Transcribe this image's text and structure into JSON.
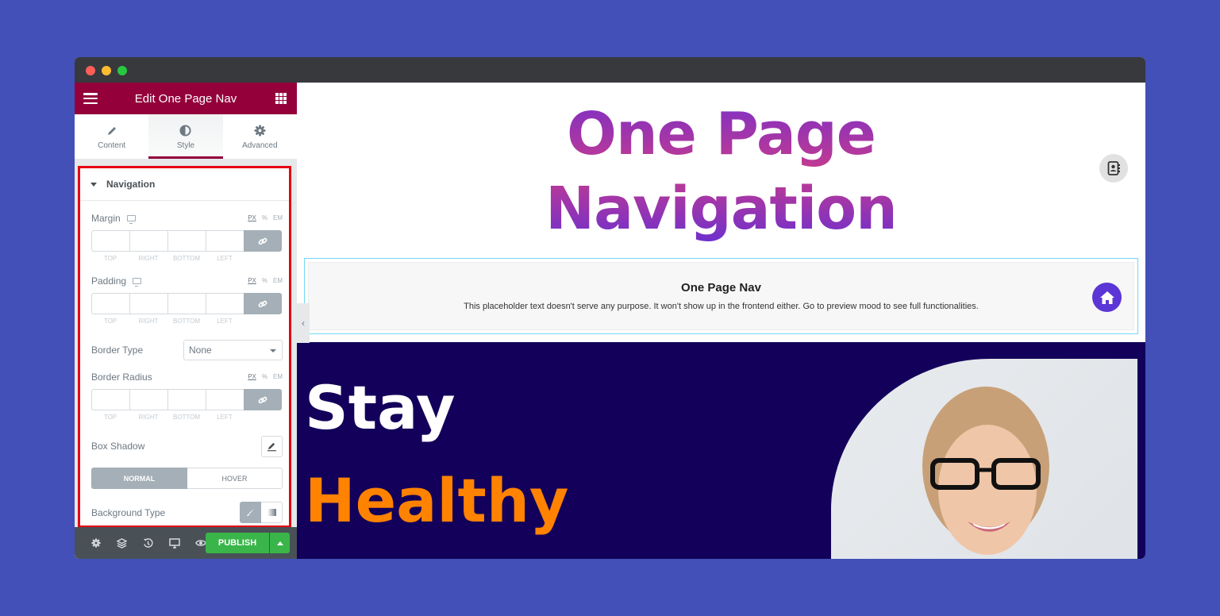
{
  "window": {
    "traffic_lights": [
      "close",
      "minimize",
      "maximize"
    ]
  },
  "sidebar": {
    "header_title": "Edit One Page Nav",
    "menu_icon": "hamburger-icon",
    "grid_icon": "apps-grid-icon",
    "tabs": [
      {
        "label": "Content",
        "icon": "pencil-icon",
        "active": false
      },
      {
        "label": "Style",
        "icon": "contrast-icon",
        "active": true
      },
      {
        "label": "Advanced",
        "icon": "gear-icon",
        "active": false
      }
    ],
    "section": {
      "title": "Navigation",
      "expanded": true
    },
    "controls": {
      "margin": {
        "label": "Margin",
        "units": [
          "PX",
          "%",
          "EM"
        ],
        "active_unit": "PX",
        "values": {
          "top": "",
          "right": "",
          "bottom": "",
          "left": ""
        },
        "dim_labels": [
          "Top",
          "Right",
          "Bottom",
          "Left"
        ]
      },
      "padding": {
        "label": "Padding",
        "units": [
          "PX",
          "%",
          "EM"
        ],
        "active_unit": "PX",
        "values": {
          "top": "",
          "right": "",
          "bottom": "",
          "left": ""
        },
        "dim_labels": [
          "Top",
          "Right",
          "Bottom",
          "Left"
        ]
      },
      "border_type": {
        "label": "Border Type",
        "value": "None"
      },
      "border_radius": {
        "label": "Border Radius",
        "units": [
          "PX",
          "%",
          "EM"
        ],
        "active_unit": "PX",
        "values": {
          "top": "",
          "right": "",
          "bottom": "",
          "left": ""
        },
        "dim_labels": [
          "Top",
          "Right",
          "Bottom",
          "Left"
        ]
      },
      "box_shadow": {
        "label": "Box Shadow"
      },
      "state_tabs": {
        "normal": "NORMAL",
        "hover": "HOVER",
        "active": "NORMAL"
      },
      "background_type": {
        "label": "Background Type",
        "options": [
          "classic",
          "gradient"
        ],
        "active": "classic"
      }
    },
    "footer": {
      "icons": [
        "settings-icon",
        "layers-icon",
        "history-icon",
        "responsive-icon",
        "preview-icon"
      ],
      "publish_label": "PUBLISH"
    }
  },
  "canvas": {
    "hero_title_line1": "One Page",
    "hero_title_line2": "Navigation",
    "widget": {
      "title": "One Page Nav",
      "description": "This placeholder text doesn't serve any purpose. It won't show up in the frontend either. Go to preview mood to see full functionalities."
    },
    "banner": {
      "line1": "Stay",
      "line2": "Healthy"
    }
  },
  "colors": {
    "background": "#4250b7",
    "brand": "#93003a",
    "publish": "#39b54a",
    "highlight_border": "#e60012",
    "banner_bg": "#13005a",
    "accent_orange": "#ff8200",
    "nav_dot": "#5b35d5"
  }
}
